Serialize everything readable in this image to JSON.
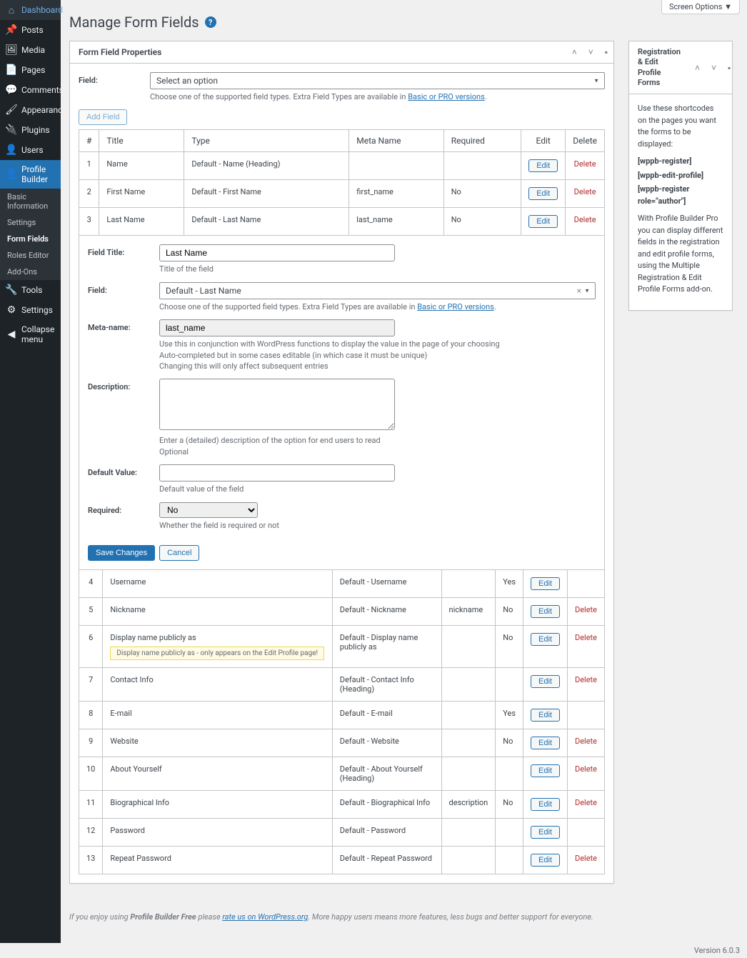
{
  "screen_options": "Screen Options",
  "page_title": "Manage Form Fields",
  "sidebar": {
    "items": [
      {
        "icon": "⌂",
        "label": "Dashboard"
      },
      {
        "icon": "📌",
        "label": "Posts"
      },
      {
        "icon": "🖼",
        "label": "Media"
      },
      {
        "icon": "📄",
        "label": "Pages"
      },
      {
        "icon": "💬",
        "label": "Comments"
      },
      {
        "icon": "🖌",
        "label": "Appearance"
      },
      {
        "icon": "🔌",
        "label": "Plugins"
      },
      {
        "icon": "👤",
        "label": "Users"
      },
      {
        "icon": "👤",
        "label": "Profile Builder",
        "active": true
      },
      {
        "icon": "🔧",
        "label": "Tools"
      },
      {
        "icon": "⚙",
        "label": "Settings"
      },
      {
        "icon": "◀",
        "label": "Collapse menu"
      }
    ],
    "sub": [
      "Basic Information",
      "Settings",
      "Form Fields",
      "Roles Editor",
      "Add-Ons"
    ],
    "sub_current": "Form Fields"
  },
  "panel": {
    "title": "Form Field Properties",
    "field_label": "Field:",
    "field_select": "Select an option",
    "field_help": "Choose one of the supported field types. Extra Field Types are available in ",
    "field_help_link": "Basic or PRO versions",
    "add_button": "Add Field"
  },
  "table": {
    "headers": [
      "#",
      "Title",
      "Type",
      "Meta Name",
      "Required",
      "Edit",
      "Delete"
    ],
    "rows_top": [
      {
        "n": "1",
        "title": "Name",
        "type": "Default - Name (Heading)",
        "meta": "",
        "req": "",
        "del": true
      },
      {
        "n": "2",
        "title": "First Name",
        "type": "Default - First Name",
        "meta": "first_name",
        "req": "No",
        "del": true
      },
      {
        "n": "3",
        "title": "Last Name",
        "type": "Default - Last Name",
        "meta": "last_name",
        "req": "No",
        "del": true
      }
    ],
    "rows_bottom": [
      {
        "n": "4",
        "title": "Username",
        "type": "Default - Username",
        "meta": "",
        "req": "Yes",
        "del": false
      },
      {
        "n": "5",
        "title": "Nickname",
        "type": "Default - Nickname",
        "meta": "nickname",
        "req": "No",
        "del": true
      },
      {
        "n": "6",
        "title": "Display name publicly as",
        "type": "Default - Display name publicly as",
        "meta": "",
        "req": "No",
        "del": true,
        "note": "Display name publicly as - only appears on the Edit Profile page!"
      },
      {
        "n": "7",
        "title": "Contact Info",
        "type": "Default - Contact Info (Heading)",
        "meta": "",
        "req": "",
        "del": true
      },
      {
        "n": "8",
        "title": "E-mail",
        "type": "Default - E-mail",
        "meta": "",
        "req": "Yes",
        "del": false
      },
      {
        "n": "9",
        "title": "Website",
        "type": "Default - Website",
        "meta": "",
        "req": "No",
        "del": true
      },
      {
        "n": "10",
        "title": "About Yourself",
        "type": "Default - About Yourself (Heading)",
        "meta": "",
        "req": "",
        "del": true
      },
      {
        "n": "11",
        "title": "Biographical Info",
        "type": "Default - Biographical Info",
        "meta": "description",
        "req": "No",
        "del": true
      },
      {
        "n": "12",
        "title": "Password",
        "type": "Default - Password",
        "meta": "",
        "req": "",
        "del": false
      },
      {
        "n": "13",
        "title": "Repeat Password",
        "type": "Default - Repeat Password",
        "meta": "",
        "req": "",
        "del": true
      }
    ],
    "edit_label": "Edit",
    "delete_label": "Delete"
  },
  "edit": {
    "title_label": "Field Title:",
    "title_value": "Last Name",
    "title_help": "Title of the field",
    "field_label": "Field:",
    "field_value": "Default - Last Name",
    "field_help": "Choose one of the supported field types. Extra Field Types are available in ",
    "field_help_link": "Basic or PRO versions",
    "meta_label": "Meta-name:",
    "meta_value": "last_name",
    "meta_help1": "Use this in conjunction with WordPress functions to display the value in the page of your choosing",
    "meta_help2": "Auto-completed but in some cases editable (in which case it must be unique)",
    "meta_help3": "Changing this will only affect subsequent entries",
    "desc_label": "Description:",
    "desc_help1": "Enter a (detailed) description of the option for end users to read",
    "desc_help2": "Optional",
    "default_label": "Default Value:",
    "default_help": "Default value of the field",
    "req_label": "Required:",
    "req_value": "No",
    "req_help": "Whether the field is required or not",
    "save": "Save Changes",
    "cancel": "Cancel"
  },
  "sidebox": {
    "title": "Registration & Edit Profile Forms",
    "p1": "Use these shortcodes on the pages you want the forms to be displayed:",
    "code1": "[wppb-register]",
    "code2": "[wppb-edit-profile]",
    "code3": "[wppb-register role=\"author\"]",
    "p2": "With Profile Builder Pro you can display different fields in the registration and edit profile forms, using the Multiple Registration & Edit Profile Forms add-on."
  },
  "footer": {
    "text1": "If you enjoy using ",
    "bold": "Profile Builder Free",
    "text2": " please ",
    "link": "rate us on WordPress.org",
    "text3": ". More happy users means more features, less bugs and better support for everyone.",
    "version": "Version 6.0.3"
  }
}
